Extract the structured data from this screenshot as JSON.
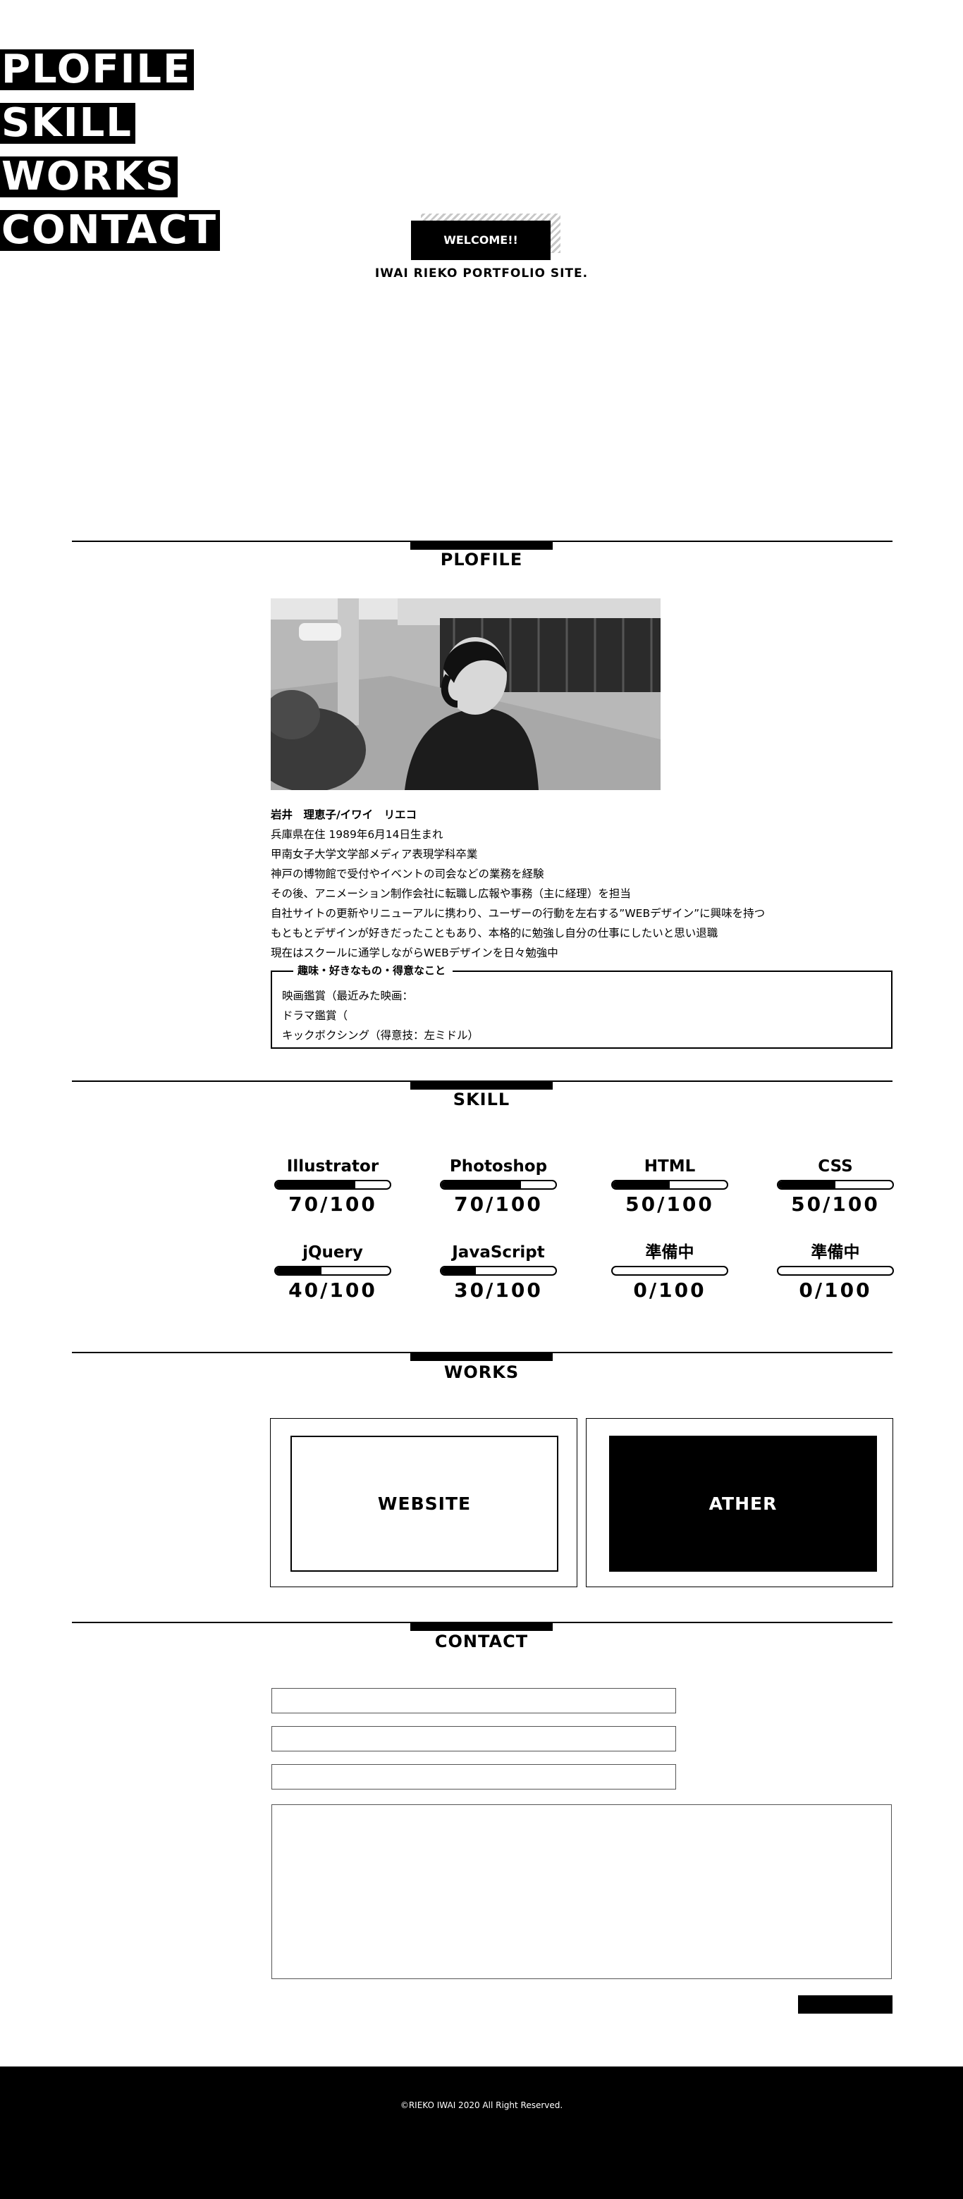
{
  "nav": {
    "items": [
      {
        "label": "PLOFILE"
      },
      {
        "label": "SKILL"
      },
      {
        "label": "WORKS"
      },
      {
        "label": "CONTACT"
      }
    ]
  },
  "hero": {
    "welcome_label": "WELCOME!!",
    "subtitle": "IWAI RIEKO PORTFOLIO SITE."
  },
  "sections": {
    "profile_title": "PLOFILE",
    "skill_title": "SKILL",
    "works_title": "WORKS",
    "contact_title": "CONTACT"
  },
  "profile": {
    "name": "岩井　理恵子/イワイ　リエコ",
    "lines": [
      "兵庫県在住 1989年6月14日生まれ",
      "甲南女子大学文学部メディア表現学科卒業",
      "神戸の博物館で受付やイベントの司会などの業務を経験",
      "その後、アニメーション制作会社に転職し広報や事務（主に経理）を担当",
      "自社サイトの更新やリニューアルに携わり、ユーザーの行動を左右する”WEBデザイン”に興味を持つ",
      "もともとデザインが好きだったこともあり、本格的に勉強し自分の仕事にしたいと思い退職",
      "現在はスクールに通学しながらWEBデザインを日々勉強中"
    ],
    "hobby_title": "趣味・好きなもの・得意なこと",
    "hobbies": [
      "映画鑑賞（最近みた映画：",
      "ドラマ鑑賞（",
      "キックボクシング（得意技：左ミドル）"
    ]
  },
  "skills": [
    {
      "name": "Illustrator",
      "score": "70/100",
      "level": 0.7
    },
    {
      "name": "Photoshop",
      "score": "70/100",
      "level": 0.7
    },
    {
      "name": "HTML",
      "score": "50/100",
      "level": 0.5
    },
    {
      "name": "CSS",
      "score": "50/100",
      "level": 0.5
    },
    {
      "name": "jQuery",
      "score": "40/100",
      "level": 0.4
    },
    {
      "name": "JavaScript",
      "score": "30/100",
      "level": 0.3
    },
    {
      "name": "準備中",
      "score": "0/100",
      "level": 0
    },
    {
      "name": "準備中",
      "score": "0/100",
      "level": 0
    }
  ],
  "works": {
    "website_label": "WEBSITE",
    "other_label": "ATHER"
  },
  "contact": {
    "submit_label": ""
  },
  "footer": {
    "copyright": "©RIEKO IWAI 2020 All Right Reserved."
  }
}
